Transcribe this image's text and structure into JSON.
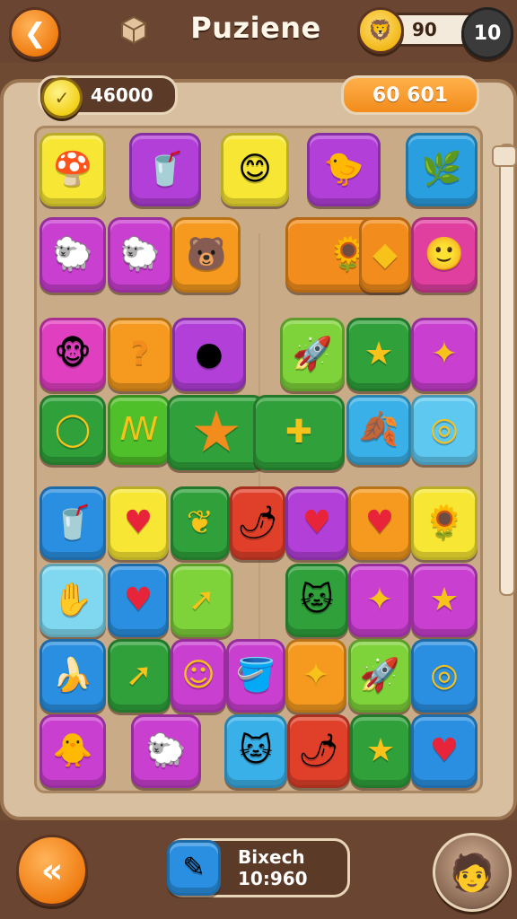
{
  "header": {
    "title": "Puziene",
    "level_score": "90",
    "level_number": "10",
    "icons": {
      "back": "back-chevron-icon",
      "cube": "cube-icon",
      "avatar": "lion-avatar-icon"
    }
  },
  "stats": {
    "coins": "46000",
    "score": "60 601"
  },
  "footer": {
    "item_name": "Bixech",
    "item_value": "10:960"
  },
  "colors": {
    "accent": "#f28c1c",
    "board": "#d8bfa0",
    "header": "#6a4632"
  },
  "tiles": [
    {
      "icon": "mushroom-face",
      "glyph": "🍄",
      "color": "#f7e633"
    },
    {
      "icon": "cup-face",
      "glyph": "🥤",
      "color": "#b23fd8"
    },
    {
      "icon": "sun-face",
      "glyph": "😊",
      "color": "#f7e633"
    },
    {
      "icon": "chick",
      "glyph": "🐤",
      "color": "#b23fd8"
    },
    {
      "icon": "flower-branch",
      "glyph": "🌿",
      "color": "#2a9fe0"
    },
    {
      "icon": "sheep-face",
      "glyph": "🐑",
      "color": "#c93fd0"
    },
    {
      "icon": "sheep-face",
      "glyph": "🐑",
      "color": "#c93fd0"
    },
    {
      "icon": "bear-face",
      "glyph": "🐻",
      "color": "#f59a1e"
    },
    {
      "icon": "sunflower",
      "glyph": "🌻",
      "color": "#f28c1c"
    },
    {
      "icon": "diamond",
      "glyph": "◆",
      "color": "#f28c1c"
    },
    {
      "icon": "green-smiley",
      "glyph": "🙂",
      "color": "#e03fa0"
    },
    {
      "icon": "monkey-face",
      "glyph": "🐵",
      "color": "#e03fc0"
    },
    {
      "icon": "question",
      "glyph": "?",
      "color": "#f59a1e"
    },
    {
      "icon": "orange-blob",
      "glyph": "●",
      "color": "#b23fd8"
    },
    {
      "icon": "rocket",
      "glyph": "🚀",
      "color": "#7ed23a"
    },
    {
      "icon": "star",
      "glyph": "★",
      "color": "#2fa03a"
    },
    {
      "icon": "shooting-star",
      "glyph": "✦",
      "color": "#c93fd0"
    },
    {
      "icon": "ring-q",
      "glyph": "◯",
      "color": "#2fa03a"
    },
    {
      "icon": "curl",
      "glyph": "ꟿ",
      "color": "#4fc02a"
    },
    {
      "icon": "star-big",
      "glyph": "★",
      "color": "#2fa03a"
    },
    {
      "icon": "arrow-shape",
      "glyph": "✚",
      "color": "#2fa03a"
    },
    {
      "icon": "leaf",
      "glyph": "🍂",
      "color": "#3ab0e8"
    },
    {
      "icon": "target",
      "glyph": "◎",
      "color": "#5fc8f0"
    },
    {
      "icon": "cup-face",
      "glyph": "🥤",
      "color": "#2a8fe0"
    },
    {
      "icon": "heart",
      "glyph": "♥",
      "color": "#f7e633"
    },
    {
      "icon": "heart-split",
      "glyph": "❦",
      "color": "#2fa03a"
    },
    {
      "icon": "pepper",
      "glyph": "🌶",
      "color": "#e0402a"
    },
    {
      "icon": "heart",
      "glyph": "♥",
      "color": "#b23fd8"
    },
    {
      "icon": "heart",
      "glyph": "♥",
      "color": "#f59a1e"
    },
    {
      "icon": "sunflower",
      "glyph": "🌻",
      "color": "#f7e633"
    },
    {
      "icon": "hand",
      "glyph": "✋",
      "color": "#7fd8f0"
    },
    {
      "icon": "heart",
      "glyph": "♥",
      "color": "#2a8fe0"
    },
    {
      "icon": "arrow-up",
      "glyph": "➚",
      "color": "#7ed23a"
    },
    {
      "icon": "cat-face",
      "glyph": "🐱",
      "color": "#2fa03a"
    },
    {
      "icon": "shooting-star",
      "glyph": "✦",
      "color": "#c93fd0"
    },
    {
      "icon": "star",
      "glyph": "★",
      "color": "#c93fd0"
    },
    {
      "icon": "banana",
      "glyph": "🍌",
      "color": "#2a8fe0"
    },
    {
      "icon": "arrow-up",
      "glyph": "➚",
      "color": "#2fa03a"
    },
    {
      "icon": "smile",
      "glyph": "☺",
      "color": "#c93fd0"
    },
    {
      "icon": "bucket-face",
      "glyph": "🪣",
      "color": "#c93fd0"
    },
    {
      "icon": "shooting-star",
      "glyph": "✦",
      "color": "#f59a1e"
    },
    {
      "icon": "rocket",
      "glyph": "🚀",
      "color": "#7ed23a"
    },
    {
      "icon": "target",
      "glyph": "◎",
      "color": "#2a8fe0"
    },
    {
      "icon": "chick",
      "glyph": "🐥",
      "color": "#c93fd0"
    },
    {
      "icon": "sheep-face",
      "glyph": "🐑",
      "color": "#c93fd0"
    },
    {
      "icon": "cat-face",
      "glyph": "🐱",
      "color": "#3ab0e8"
    },
    {
      "icon": "pepper",
      "glyph": "🌶",
      "color": "#e0402a"
    },
    {
      "icon": "star",
      "glyph": "★",
      "color": "#2fa03a"
    },
    {
      "icon": "heart",
      "glyph": "♥",
      "color": "#2a8fe0"
    }
  ]
}
